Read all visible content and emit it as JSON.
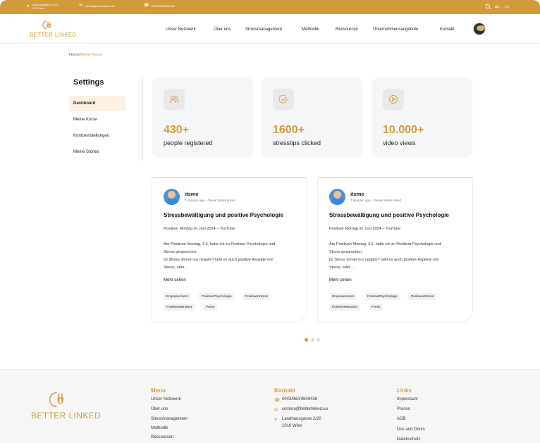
{
  "topbar": {
    "address_line1": "Landhausgasse 2/20",
    "address_line2": "1010 Wien",
    "email": "corinna@betterlinked.eu",
    "phone": "0043/660/3609436",
    "lang_de": "DE",
    "lang_en": "EN"
  },
  "brand": {
    "logo_text": "BETTER LINKED",
    "accent_color": "#d39a3c"
  },
  "nav": {
    "items": [
      "Unser Netzwerk",
      "Über uns",
      "Stressmanagement",
      "Methodik",
      "Ressourcen",
      "Unternehmensangebote",
      "Kontakt"
    ]
  },
  "breadcrumb": {
    "home": "Home/",
    "current": "Meine Kurse"
  },
  "settings": {
    "title": "Settings",
    "items": [
      "Dashboard",
      "Meine Kurse",
      "Konto­einstellungen",
      "Meine Stories"
    ]
  },
  "stats": [
    {
      "icon": "users-icon",
      "value": "430+",
      "label": "people registered"
    },
    {
      "icon": "check-circle-icon",
      "value": "1600+",
      "label": "stresstips clicked"
    },
    {
      "icon": "play-circle-icon",
      "value": "10.000+",
      "label": "video views"
    }
  ],
  "posts": [
    {
      "author": "itsme",
      "meta": "7 stunden ago - Owner Better linked",
      "title": "Stressbewältigung und positive Psychologie",
      "subtitle": "Positiver Montag im Juni 2024 – YouTube",
      "body1": "Am Positiven Montag, 3.6. habe ich zu Positiver Psychologie und",
      "body2": "Stress gesprochen.",
      "body3": "Ist Stress immer nur negativ? Gibt es auch positive Aspekte von",
      "body4": "Stress, oder ...",
      "more": "Mehr sehen",
      "tags": [
        "Empowerment",
        "PositivePsychologie",
        "PositiverStress",
        "PositivesMindset",
        "Press"
      ]
    },
    {
      "author": "itsme",
      "meta": "7 stunden ago - Owner Better linked",
      "title": "Stressbewältigung und positive Psychologie",
      "subtitle": "Positiver Montag im Juni 2024 – YouTube",
      "body1": "Am Positiven Montag, 3.6. habe ich zu Positiver Psychologie und",
      "body2": "Stress gesprochen.",
      "body3": "Ist Stress immer nur negativ? Gibt es auch positive Aspekte von",
      "body4": "Stress, oder ...",
      "more": "Mehr sehen",
      "tags": [
        "Empowerment",
        "PositivePsychologie",
        "PositiverStress",
        "PositivesMindset",
        "Press"
      ]
    }
  ],
  "footer": {
    "menu_title": "Menu",
    "menu_items": [
      "Unser Netzwerk",
      "Über uns",
      "Stressmanagement",
      "Methodik",
      "Ressourcen"
    ],
    "contact_title": "Kontakt",
    "contact_phone": "0043/660/3609436",
    "contact_email": "corinna@betterlinked.eu",
    "contact_address1": "Landhausgasse 2/20",
    "contact_address2": "1010 Wien",
    "links_title": "Links",
    "links_items": [
      "Impressum",
      "Presse",
      "AGB",
      "Dos and Donts",
      "Datenschutz"
    ]
  }
}
